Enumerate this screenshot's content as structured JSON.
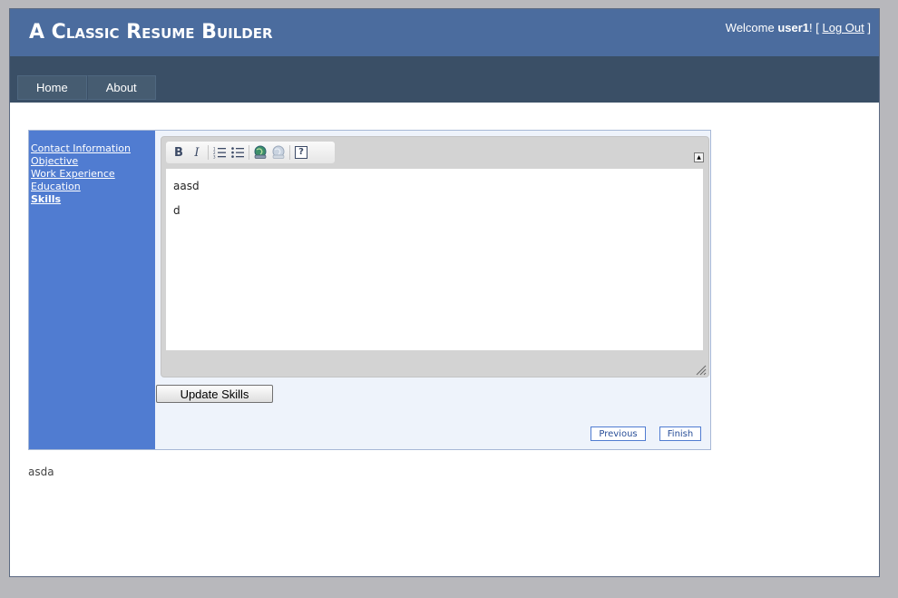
{
  "header": {
    "site_title": "A Classic Resume Builder",
    "welcome_prefix": "Welcome ",
    "username": "user1",
    "welcome_suffix": "! [ ",
    "logout_label": "Log Out",
    "bracket_close": " ]"
  },
  "menu": {
    "items": [
      {
        "label": "Home"
      },
      {
        "label": "About"
      }
    ]
  },
  "wizard": {
    "steps": [
      {
        "label": "Contact Information",
        "active": false
      },
      {
        "label": "Objective",
        "active": false
      },
      {
        "label": "Work Experience",
        "active": false
      },
      {
        "label": "Education",
        "active": false
      },
      {
        "label": "Skills",
        "active": true
      }
    ],
    "editor": {
      "toolbar": [
        {
          "icon": "bold-icon",
          "glyph": "B"
        },
        {
          "icon": "italic-icon",
          "glyph": "I"
        },
        {
          "icon": "numbered-list-icon"
        },
        {
          "icon": "bullet-list-icon"
        },
        {
          "icon": "insert-link-icon"
        },
        {
          "icon": "remove-link-icon"
        },
        {
          "icon": "help-icon",
          "glyph": "?"
        }
      ],
      "content": [
        "aasd",
        "d"
      ]
    },
    "update_label": "Update Skills",
    "previous_label": "Previous",
    "finish_label": "Finish"
  },
  "footer_text": "asda",
  "colors": {
    "header_bg": "#4b6c9e",
    "navbar_bg": "#3a4f66",
    "wizard_side_bg": "#507cd1",
    "wizard_bg": "#eef3fb"
  }
}
